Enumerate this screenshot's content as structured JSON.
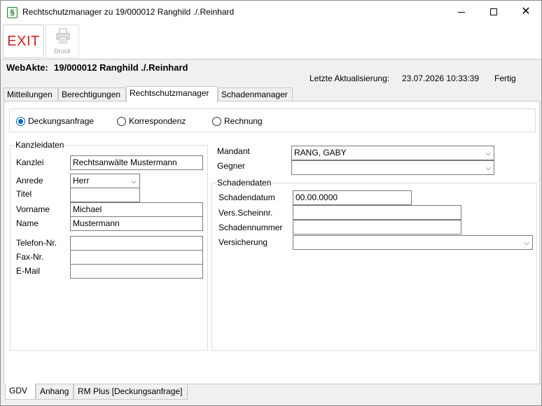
{
  "window": {
    "title": "Rechtschutzmanager zu 19/000012 Ranghild ./.Reinhard",
    "icon_glyph": "§"
  },
  "toolbar": {
    "exit_label": "EXIT",
    "print_label": "Druck"
  },
  "header": {
    "webakte_label": "WebAkte:",
    "webakte_value": "19/000012 Ranghild ./.Reinhard",
    "update_label": "Letzte Aktualisierung:",
    "update_value": "23.07.2026 10:33:39",
    "status": "Fertig"
  },
  "tabs_top": [
    "Mitteilungen",
    "Berechtigungen",
    "Rechtschutzmanager",
    "Schadenmanager"
  ],
  "active_top_tab": "Rechtschutzmanager",
  "radios": [
    {
      "label": "Deckungsanfrage",
      "selected": true
    },
    {
      "label": "Korrespondenz",
      "selected": false
    },
    {
      "label": "Rechnung",
      "selected": false
    }
  ],
  "kanzlei": {
    "group_title": "Kanzleidaten",
    "kanzlei_label": "Kanzlei",
    "kanzlei_value": "Rechtsanwälte Mustermann",
    "anrede_label": "Anrede",
    "anrede_value": "Herr",
    "titel_label": "Titel",
    "titel_value": "",
    "vorname_label": "Vorname",
    "vorname_value": "Michael",
    "name_label": "Name",
    "name_value": "Mustermann",
    "telefon_label": "Telefon-Nr.",
    "telefon_value": "",
    "fax_label": "Fax-Nr.",
    "fax_value": "",
    "email_label": "E-Mail",
    "email_value": ""
  },
  "parteien": {
    "mandant_label": "Mandant",
    "mandant_value": "RANG, GABY",
    "gegner_label": "Gegner",
    "gegner_value": ""
  },
  "schaden": {
    "group_title": "Schadendaten",
    "datum_label": "Schadendatum",
    "datum_value": "00.00.0000",
    "schein_label": "Vers.Scheinnr.",
    "schein_value": "",
    "nummer_label": "Schadennummer",
    "nummer_value": "",
    "versicherung_label": "Versicherung",
    "versicherung_value": ""
  },
  "tabs_bottom": [
    "GDV",
    "Anhang",
    "RM Plus [Deckungsanfrage]"
  ],
  "active_bottom_tab": "GDV",
  "colors": {
    "exit_red": "#d21e1e",
    "radio_blue": "#0067c0"
  }
}
